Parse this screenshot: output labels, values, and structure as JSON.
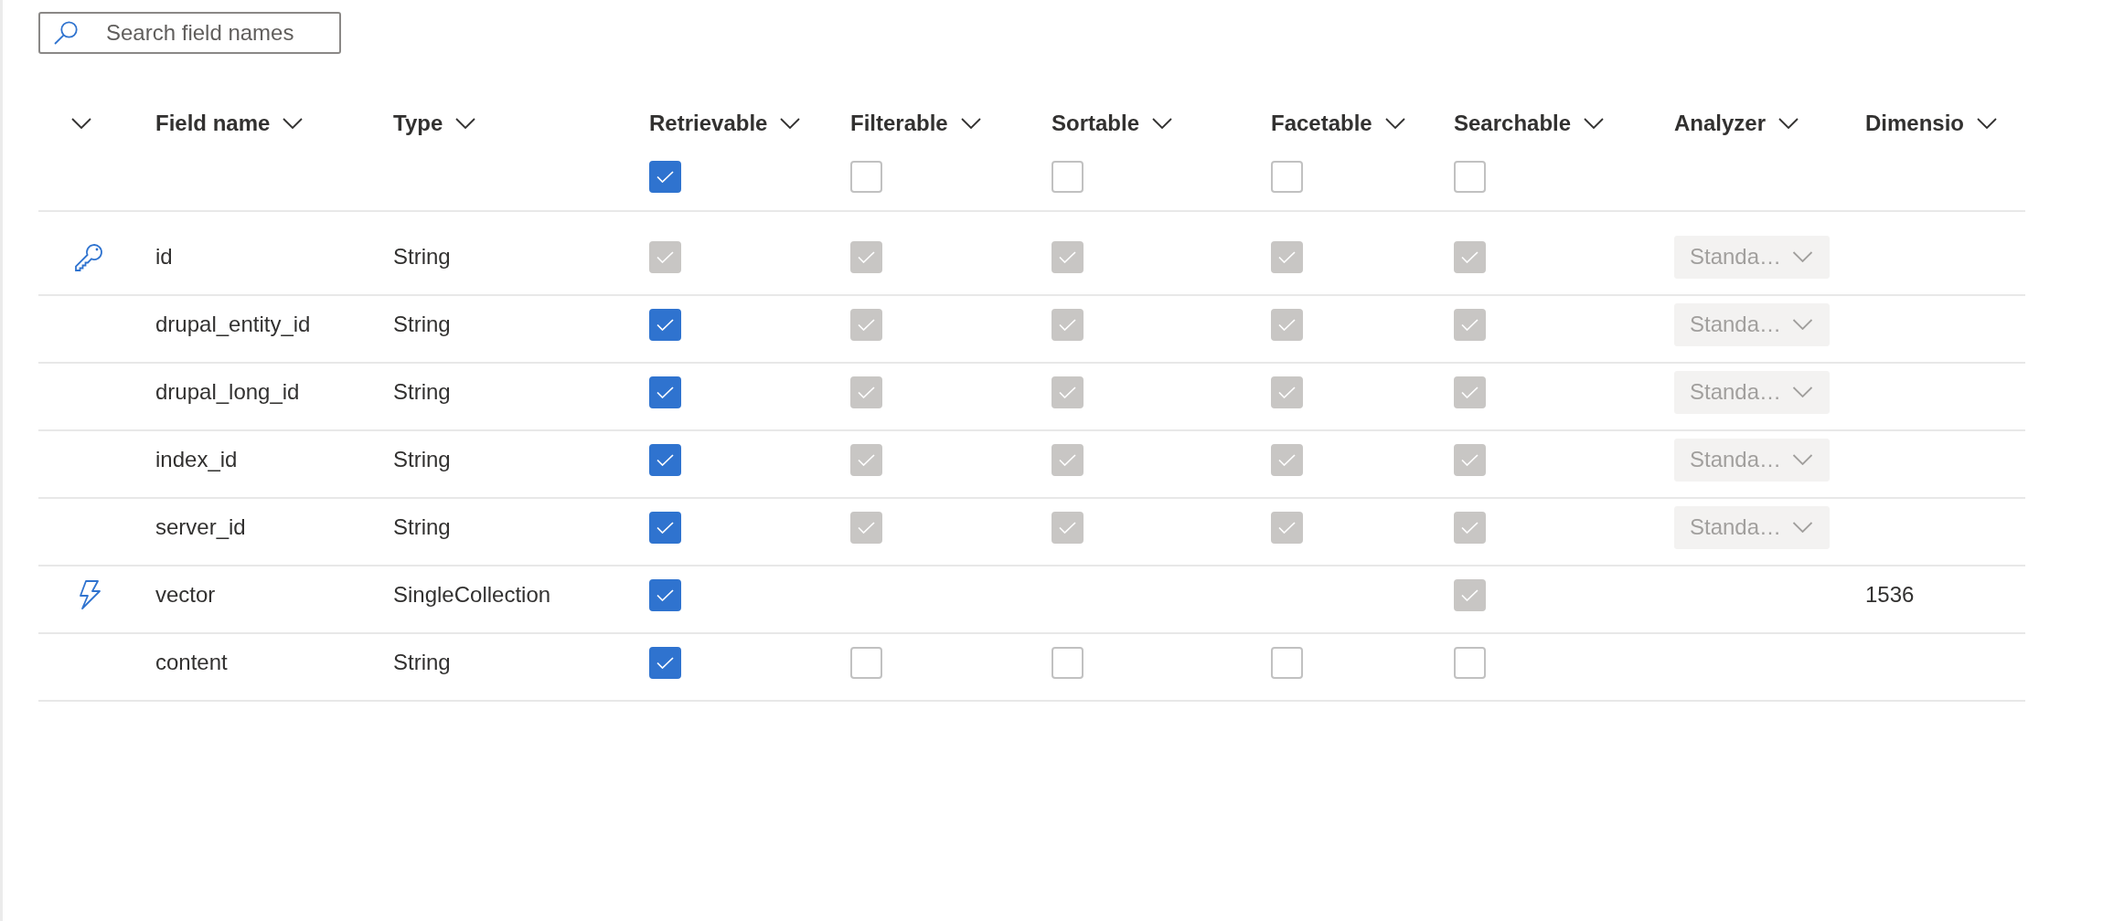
{
  "search": {
    "placeholder": "Search field names"
  },
  "table": {
    "columns": [
      {
        "kind": "menu"
      },
      {
        "kind": "text",
        "label": "Field name"
      },
      {
        "kind": "text",
        "label": "Type"
      },
      {
        "kind": "flag",
        "label": "Retrievable",
        "select_all": {
          "checked": true
        }
      },
      {
        "kind": "flag",
        "label": "Filterable",
        "select_all": {
          "checked": false
        }
      },
      {
        "kind": "flag",
        "label": "Sortable",
        "select_all": {
          "checked": false
        }
      },
      {
        "kind": "flag",
        "label": "Facetable",
        "select_all": {
          "checked": false
        }
      },
      {
        "kind": "flag",
        "label": "Searchable",
        "select_all": {
          "checked": false
        }
      },
      {
        "kind": "text",
        "label": "Analyzer"
      },
      {
        "kind": "text",
        "label": "Dimensio"
      }
    ],
    "rows": [
      {
        "kind": "key",
        "name": "id",
        "type": "String",
        "retrievable": {
          "checked": true,
          "disabled": true
        },
        "filterable": {
          "checked": true,
          "disabled": true
        },
        "sortable": {
          "checked": true,
          "disabled": true
        },
        "facetable": {
          "checked": true,
          "disabled": true
        },
        "searchable": {
          "checked": true,
          "disabled": true
        },
        "analyzer": {
          "value": "Standa…",
          "disabled": true
        }
      },
      {
        "kind": "plain",
        "name": "drupal_entity_id",
        "type": "String",
        "retrievable": {
          "checked": true,
          "disabled": false
        },
        "filterable": {
          "checked": true,
          "disabled": true
        },
        "sortable": {
          "checked": true,
          "disabled": true
        },
        "facetable": {
          "checked": true,
          "disabled": true
        },
        "searchable": {
          "checked": true,
          "disabled": true
        },
        "analyzer": {
          "value": "Standa…",
          "disabled": true
        }
      },
      {
        "kind": "plain",
        "name": "drupal_long_id",
        "type": "String",
        "retrievable": {
          "checked": true,
          "disabled": false
        },
        "filterable": {
          "checked": true,
          "disabled": true
        },
        "sortable": {
          "checked": true,
          "disabled": true
        },
        "facetable": {
          "checked": true,
          "disabled": true
        },
        "searchable": {
          "checked": true,
          "disabled": true
        },
        "analyzer": {
          "value": "Standa…",
          "disabled": true
        }
      },
      {
        "kind": "plain",
        "name": "index_id",
        "type": "String",
        "retrievable": {
          "checked": true,
          "disabled": false
        },
        "filterable": {
          "checked": true,
          "disabled": true
        },
        "sortable": {
          "checked": true,
          "disabled": true
        },
        "facetable": {
          "checked": true,
          "disabled": true
        },
        "searchable": {
          "checked": true,
          "disabled": true
        },
        "analyzer": {
          "value": "Standa…",
          "disabled": true
        }
      },
      {
        "kind": "plain",
        "name": "server_id",
        "type": "String",
        "retrievable": {
          "checked": true,
          "disabled": false
        },
        "filterable": {
          "checked": true,
          "disabled": true
        },
        "sortable": {
          "checked": true,
          "disabled": true
        },
        "facetable": {
          "checked": true,
          "disabled": true
        },
        "searchable": {
          "checked": true,
          "disabled": true
        },
        "analyzer": {
          "value": "Standa…",
          "disabled": true
        }
      },
      {
        "kind": "vector",
        "name": "vector",
        "type": "SingleCollection",
        "retrievable": {
          "checked": true,
          "disabled": false
        },
        "searchable": {
          "checked": true,
          "disabled": true
        },
        "dimension": "1536"
      },
      {
        "kind": "plain",
        "name": "content",
        "type": "String",
        "retrievable": {
          "checked": true,
          "disabled": false
        },
        "filterable": {
          "checked": false,
          "disabled": false
        },
        "sortable": {
          "checked": false,
          "disabled": false
        },
        "facetable": {
          "checked": false,
          "disabled": false
        },
        "searchable": {
          "checked": false,
          "disabled": false
        }
      }
    ]
  }
}
